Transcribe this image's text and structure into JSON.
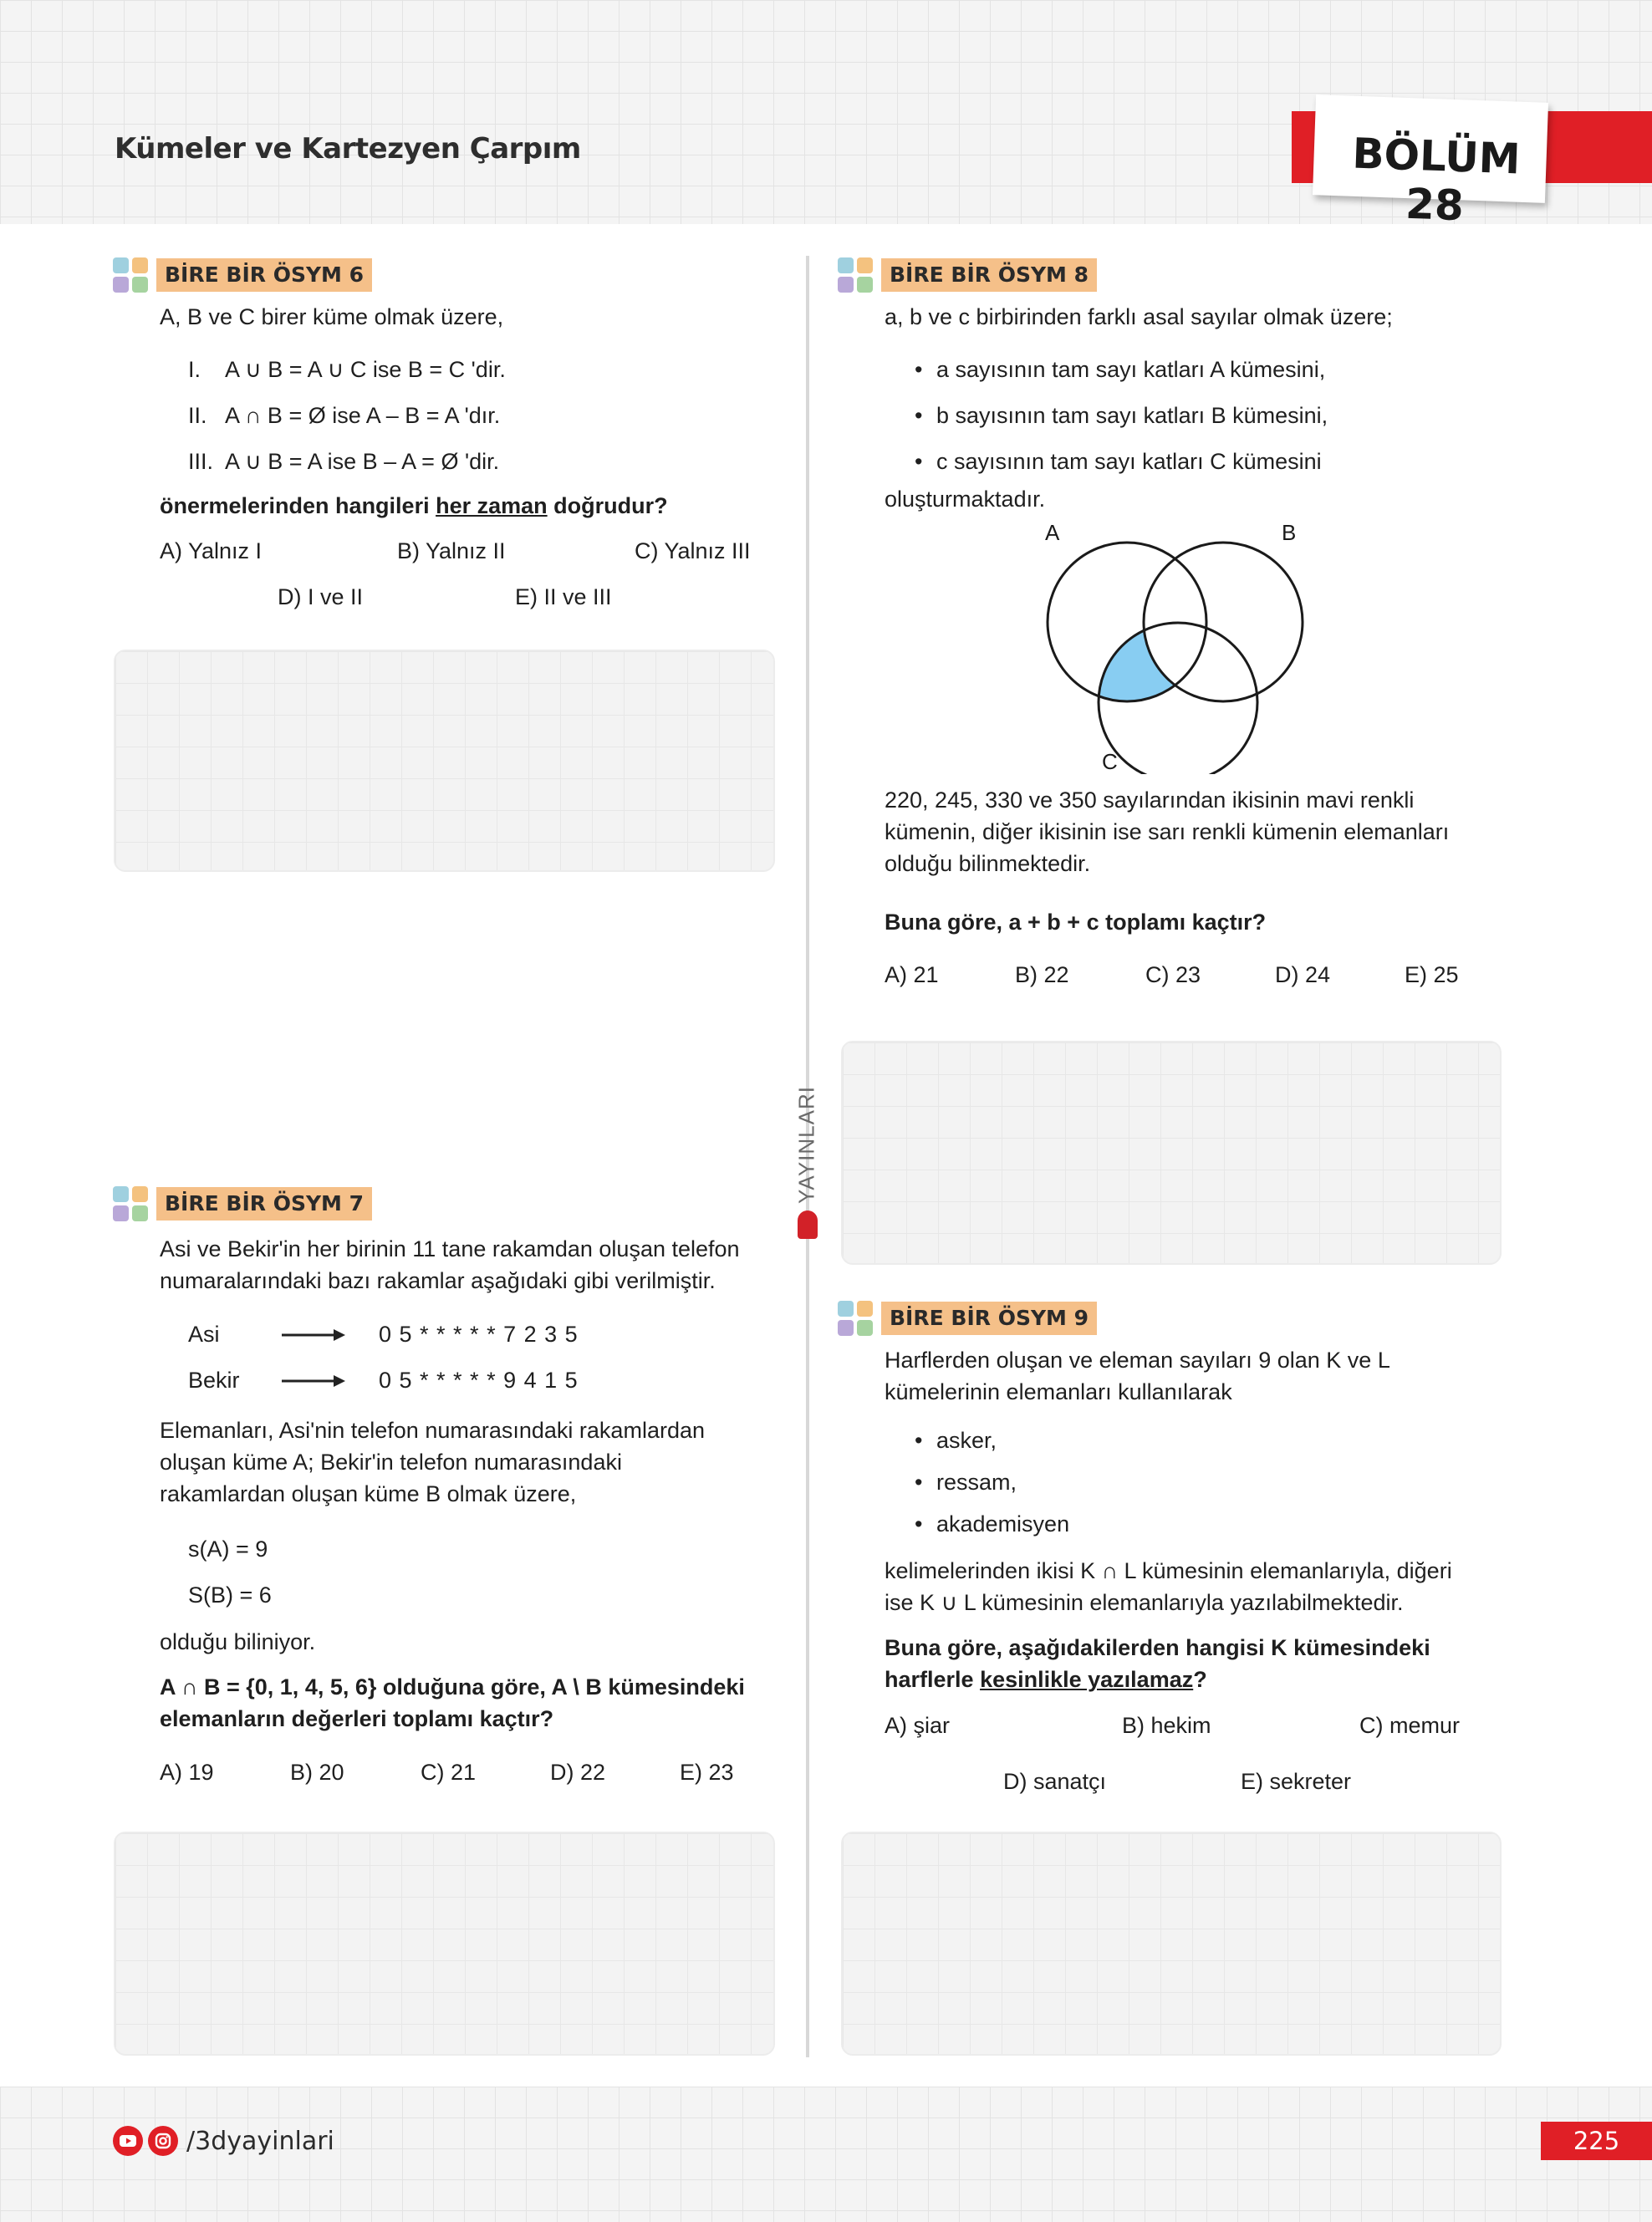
{
  "header": {
    "title": "Kümeler ve Kartezyen Çarpım",
    "chapter": "BÖLÜM 28"
  },
  "publisher": {
    "name": "YAYINLARI"
  },
  "footer": {
    "social_handle": "/3dyayinlari",
    "page_number": "225"
  },
  "q6": {
    "tag": "BİRE BİR ÖSYM 6",
    "intro": "A, B ve C birer küme olmak üzere,",
    "statements": [
      {
        "num": "I.",
        "text": "A ∪ B = A ∪ C  ise  B = C 'dir."
      },
      {
        "num": "II.",
        "text": "A ∩ B = Ø  ise  A – B = A 'dır."
      },
      {
        "num": "III.",
        "text": "A ∪ B = A  ise  B – A = Ø 'dir."
      }
    ],
    "question_pre": "önermelerinden hangileri ",
    "question_ul": "her zaman",
    "question_post": " doğrudur?",
    "options": [
      "A) Yalnız I",
      "B) Yalnız II",
      "C) Yalnız III",
      "D) I ve II",
      "E) II ve III"
    ]
  },
  "q7": {
    "tag": "BİRE BİR ÖSYM 7",
    "intro": [
      "Asi ve Bekir'in her birinin 11 tane rakamdan oluşan telefon",
      "numaralarındaki bazı rakamlar aşağıdaki gibi verilmiştir."
    ],
    "phones": [
      {
        "name": "Asi",
        "number": "0 5 * *  * * *  7 2  3 5"
      },
      {
        "name": "Bekir",
        "number": "0 5 * *  * * *  9 4  1 5"
      }
    ],
    "body": [
      "Elemanları, Asi'nin telefon numarasındaki rakamlardan",
      "oluşan küme A; Bekir'in telefon numarasındaki",
      "rakamlardan oluşan küme B olmak üzere,"
    ],
    "givens": [
      "s(A) = 9",
      "S(B) = 6"
    ],
    "known": "olduğu biliniyor.",
    "question": [
      "A ∩ B = {0, 1, 4, 5, 6} olduğuna göre, A \\ B kümesindeki",
      "elemanların değerleri toplamı kaçtır?"
    ],
    "options": [
      "A) 19",
      "B) 20",
      "C) 21",
      "D) 22",
      "E) 23"
    ]
  },
  "q8": {
    "tag": "BİRE BİR ÖSYM 8",
    "intro": "a, b ve c birbirinden farklı asal sayılar olmak üzere;",
    "bullets": [
      "a sayısının tam sayı katları A kümesini,",
      "b sayısının tam sayı katları B kümesini,",
      "c sayısının tam sayı katları C kümesini"
    ],
    "after": "oluşturmaktadır.",
    "venn": {
      "labels": [
        "A",
        "B",
        "C"
      ],
      "colors": {
        "yellow": "#f8f1a0",
        "blue": "#88cdf2"
      }
    },
    "body": [
      "220, 245, 330 ve 350 sayılarından ikisinin mavi renkli",
      "kümenin, diğer ikisinin ise sarı renkli kümenin elemanları",
      "olduğu bilinmektedir."
    ],
    "question": "Buna göre, a + b + c toplamı kaçtır?",
    "options": [
      "A) 21",
      "B) 22",
      "C) 23",
      "D) 24",
      "E) 25"
    ]
  },
  "q9": {
    "tag": "BİRE BİR ÖSYM 9",
    "intro": [
      "Harflerden oluşan ve eleman sayıları 9 olan K ve L",
      "kümelerinin elemanları kullanılarak"
    ],
    "bullets": [
      "asker,",
      "ressam,",
      "akademisyen"
    ],
    "body": [
      "kelimelerinden ikisi K ∩ L kümesinin elemanlarıyla, diğeri",
      "ise K ∪ L kümesinin elemanlarıyla yazılabilmektedir."
    ],
    "question_line1": "Buna göre, aşağıdakilerden hangisi K kümesindeki",
    "question_pre": "harflerle ",
    "question_ul": "kesinlikle yazılamaz",
    "question_post": "?",
    "options": [
      "A) şiar",
      "B) hekim",
      "C) memur",
      "D) sanatçı",
      "E) sekreter"
    ]
  },
  "colors": {
    "accent_red": "#e01f26",
    "tag_bg": "#f5c089"
  }
}
